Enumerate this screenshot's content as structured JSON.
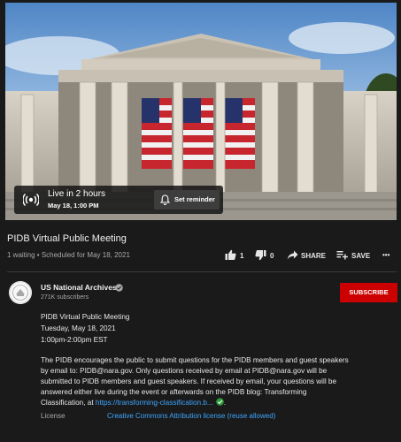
{
  "player": {
    "live_status": "Live in 2 hours",
    "live_datetime": "May 18, 1:00 PM",
    "reminder_label": "Set reminder"
  },
  "video": {
    "title": "PIDB Virtual Public Meeting",
    "meta": "1 waiting • Scheduled for May 18, 2021",
    "like_count": "1",
    "dislike_count": "0",
    "share_label": "SHARE",
    "save_label": "SAVE",
    "more_label": "•••"
  },
  "channel": {
    "name": "US National Archives",
    "subscribers": "271K subscribers",
    "subscribe_label": "SUBSCRIBE"
  },
  "description": {
    "line1": "PIDB Virtual Public Meeting",
    "line2": "Tuesday, May 18, 2021",
    "line3": "1:00pm-2:00pm EST",
    "para1": "The PIDB encourages the public to submit questions for the PIDB members and guest speakers",
    "para2": "by email to: PIDB@nara.gov. Only questions received by email at PIDB@nara.gov will be",
    "para3": "submitted to PIDB members and guest speakers. If received by email, your questions will be",
    "para4": "answered either live during the event or afterwards on the PIDB blog: Transforming",
    "para5_prefix": "Classification, at ",
    "para5_link": "https://transforming-classification.b...",
    "para5_suffix": ".",
    "license_label": "License",
    "license_value": "Creative Commons Attribution license (reuse allowed)"
  },
  "colors": {
    "background": "#1a1a1a",
    "subscribe": "#cc0000",
    "link": "#3ea6ff",
    "verified_check": "#2e9c3a"
  },
  "icons": [
    "live-broadcast-icon",
    "bell-icon",
    "thumbs-up-icon",
    "thumbs-down-icon",
    "share-icon",
    "save-playlist-icon",
    "more-icon",
    "verified-icon",
    "check-icon"
  ]
}
